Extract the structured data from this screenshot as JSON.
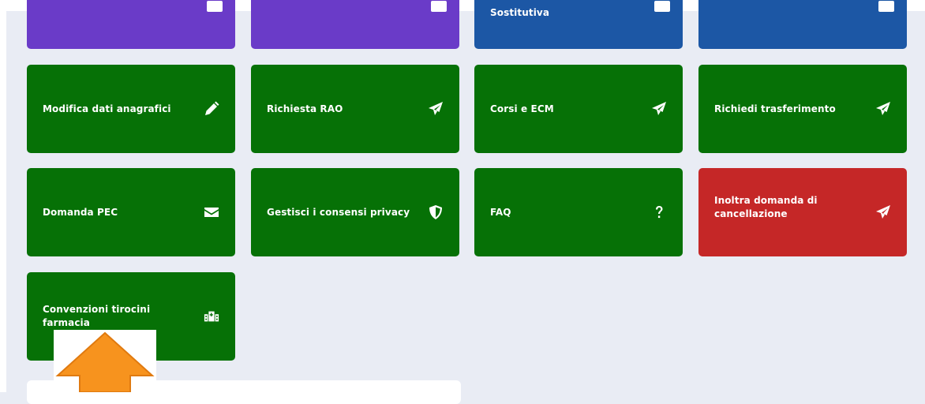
{
  "tiles_top": [
    {
      "label": "",
      "color": "#6a3bc8"
    },
    {
      "label": "",
      "color": "#6a3bc8"
    },
    {
      "label": "Sostitutiva",
      "color": "#1c57a5"
    },
    {
      "label": "",
      "color": "#1c57a5"
    }
  ],
  "tiles": [
    {
      "label": "Modifica dati anagrafici",
      "icon": "pencil-icon"
    },
    {
      "label": "Richiesta RAO",
      "icon": "paper-plane-icon"
    },
    {
      "label": "Corsi e ECM",
      "icon": "paper-plane-icon"
    },
    {
      "label": "Richiedi trasferimento",
      "icon": "paper-plane-icon"
    },
    {
      "label": "Domanda PEC",
      "icon": "envelope-icon"
    },
    {
      "label": "Gestisci i consensi privacy",
      "icon": "shield-icon"
    },
    {
      "label": "FAQ",
      "icon": "question-icon"
    },
    {
      "label": "Inoltra domanda di cancellazione",
      "icon": "paper-plane-icon"
    },
    {
      "label": "Convenzioni tirocini farmacia",
      "icon": "hospital-icon"
    }
  ],
  "colors": {
    "background": "#e9ecf4",
    "purple": "#6a3bc8",
    "blue": "#1c57a5",
    "green": "#067106",
    "red": "#c52727",
    "cursor": "#f7931e"
  }
}
